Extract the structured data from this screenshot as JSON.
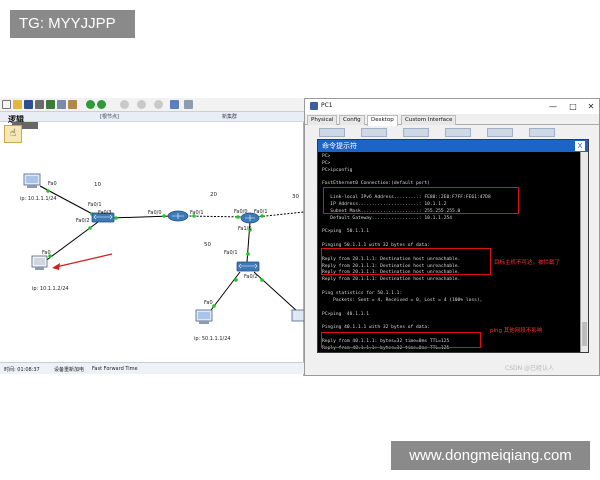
{
  "watermarks": {
    "top_tag": "TG: MYYJJPP",
    "bottom_site": "www.dongmeiqiang.com"
  },
  "pt": {
    "logic_label": "逻辑",
    "subbar": {
      "left": "[根节点]",
      "right": "新集群"
    },
    "devices": {
      "pc_top_ip": "ip: 10.1.1.1/24",
      "pc_mid_ip": "ip: 10.1.1.2/24",
      "pc_bot_ip": "ip: 50.1.1.1/24",
      "port_fa0_a": "Fa0",
      "port_fa0_b": "Fa0",
      "port_fa0_c": "Fa0",
      "sw1_fa01": "Fa0/1",
      "sw1_fa02": "Fa0/2",
      "sw1_fa03": "Fa0/3",
      "r_fa00": "Fa0/0",
      "r_fa01": "Fa0/1",
      "r2_fa00": "Fa0/0",
      "r2_fa01": "Fa0/1",
      "r2_fa10": "Fa1/0",
      "sw2_fa01": "Fa0/1",
      "sw2_fa02": "Fa0/2",
      "net10": "10",
      "net20": "20",
      "net30": "30",
      "net50": "50"
    },
    "status": {
      "time": "时间: 01:08:37",
      "power": "设备重新加电",
      "fast": "Fast Forward Time"
    }
  },
  "pc": {
    "title": "PC1",
    "tabs": [
      "Physical",
      "Config",
      "Desktop",
      "Custom Interface"
    ],
    "active_tab": "Desktop",
    "window_controls": {
      "min": "—",
      "max": "□",
      "close": "✕"
    },
    "author": "CSDN @已经认人"
  },
  "cmd": {
    "title": "命令提示符",
    "close": "X",
    "lines": [
      "PC>",
      "PC>",
      "PC>ipconfig",
      "",
      "FastEthernet0 Connection:(default port)",
      "",
      "   Link-local IPv6 Address.........: FE80::2E0:F7FF:FE61:47D8",
      "   IP Address......................: 10.1.1.2",
      "   Subnet Mask.....................: 255.255.255.0",
      "   Default Gateway.................: 10.1.1.254",
      "",
      "PC>ping  50.1.1.1",
      "",
      "Pinging 50.1.1.1 with 32 bytes of data:",
      "",
      "Reply from 20.1.1.1: Destination host unreachable.",
      "Reply from 20.1.1.1: Destination host unreachable.",
      "Reply from 20.1.1.1: Destination host unreachable.",
      "Reply from 20.1.1.1: Destination host unreachable.",
      "",
      "Ping statistics for 50.1.1.1:",
      "    Packets: Sent = 4, Received = 0, Lost = 4 (100% loss),",
      "",
      "PC>ping  40.1.1.1",
      "",
      "Pinging 40.1.1.1 with 32 bytes of data:",
      "",
      "Reply from 40.1.1.1: bytes=32 time=0ms TTL=125",
      "Reply from 40.1.1.1: bytes=32 time=0ms TTL=125"
    ],
    "note_unreachable": "目标主机不可达，被拦截了",
    "note_ping_ok": "ping 其他网段不影响"
  }
}
